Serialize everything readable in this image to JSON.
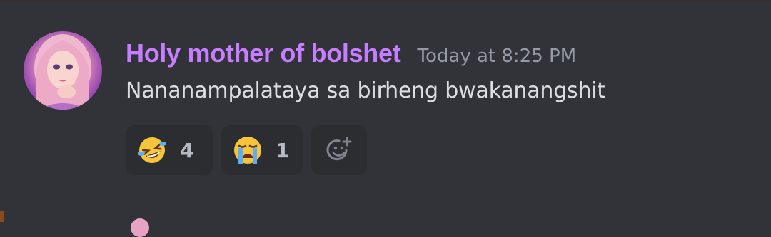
{
  "message": {
    "username": "Holy mother of bolshet",
    "timestamp": "Today at 8:25 PM",
    "content": "Nananampalataya sa birheng bwakanangshit",
    "username_color": "#c77dff",
    "avatar": "avatar-image"
  },
  "reactions": [
    {
      "emoji": "rolling-on-floor-laughing-emoji",
      "count": "4"
    },
    {
      "emoji": "loudly-crying-face-emoji",
      "count": "1"
    }
  ],
  "add_reaction": {
    "icon": "add-reaction-icon"
  },
  "colors": {
    "background": "#313338",
    "reaction_bg": "#2b2d31",
    "text": "#dbdee1",
    "muted": "#949ba4"
  }
}
